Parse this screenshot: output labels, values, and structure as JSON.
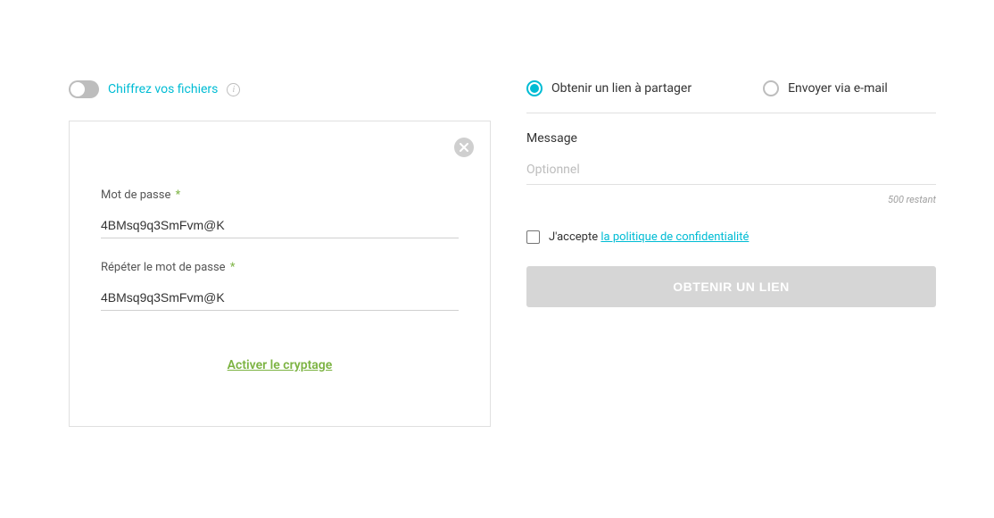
{
  "encrypt": {
    "toggle_label": "Chiffrez vos fichiers"
  },
  "password_card": {
    "password_label": "Mot de passe",
    "password_value": "4BMsq9q3SmFvm@K",
    "repeat_label": "Répéter le mot de passe",
    "repeat_value": "4BMsq9q3SmFvm@K",
    "activate_label": "Activer le cryptage"
  },
  "delivery": {
    "link_label": "Obtenir un lien à partager",
    "email_label": "Envoyer via e-mail"
  },
  "message": {
    "label": "Message",
    "placeholder": "Optionnel",
    "counter": "500 restant"
  },
  "accept": {
    "prefix": "J'accepte",
    "policy_link": "la politique de confidentialité"
  },
  "submit": {
    "label": "OBTENIR UN LIEN"
  }
}
